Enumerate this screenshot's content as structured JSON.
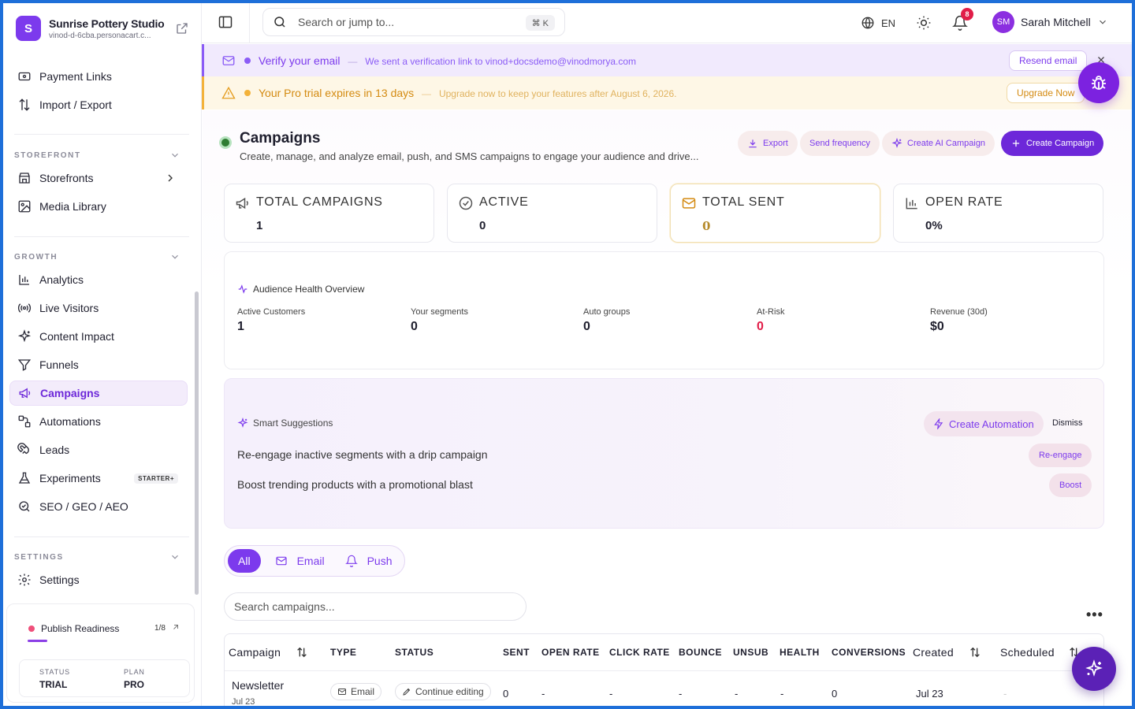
{
  "brand": {
    "initial": "S",
    "name": "Sunrise Pottery Studio",
    "subdomain": "vinod-d-6cba.personacart.c..."
  },
  "sidebar": {
    "top_items": [
      {
        "label": "Payment Links",
        "icon": "card-icon"
      },
      {
        "label": "Import / Export",
        "icon": "import-export-icon"
      }
    ],
    "sections": {
      "storefront": "STOREFRONT",
      "growth": "GROWTH",
      "settings": "SETTINGS"
    },
    "storefront_items": [
      {
        "label": "Storefronts",
        "icon": "store-icon"
      },
      {
        "label": "Media Library",
        "icon": "image-icon"
      }
    ],
    "growth_items": [
      {
        "label": "Analytics",
        "icon": "bar-chart-icon"
      },
      {
        "label": "Live Visitors",
        "icon": "broadcast-icon"
      },
      {
        "label": "Content Impact",
        "icon": "sparkle-icon"
      },
      {
        "label": "Funnels",
        "icon": "funnel-icon"
      },
      {
        "label": "Campaigns",
        "icon": "megaphone-icon",
        "active": true
      },
      {
        "label": "Automations",
        "icon": "workflow-icon"
      },
      {
        "label": "Leads",
        "icon": "magnet-icon"
      },
      {
        "label": "Experiments",
        "icon": "flask-icon",
        "badge": "STARTER+"
      },
      {
        "label": "SEO / GEO / AEO",
        "icon": "seo-search-icon"
      }
    ],
    "settings_items": [
      {
        "label": "Settings",
        "icon": "gear-icon"
      }
    ],
    "readiness": {
      "title": "Publish Readiness",
      "count": "1/8",
      "status_label": "STATUS",
      "status_value": "TRIAL",
      "plan_label": "PLAN",
      "plan_value": "PRO"
    }
  },
  "topbar": {
    "search_placeholder": "Search or jump to...",
    "shortcut": "⌘ K",
    "language": "EN",
    "notifications_count": "8",
    "user_initials": "SM",
    "user_name": "Sarah Mitchell"
  },
  "banners": {
    "verify": {
      "title": "Verify your email",
      "sep": "—",
      "text": "We sent a verification link to vinod+docsdemo@vinodmorya.com",
      "button": "Resend email"
    },
    "trial": {
      "title": "Your Pro trial expires in 13 days",
      "sep": "—",
      "text": "Upgrade now to keep your features after August 6, 2026.",
      "button": "Upgrade Now"
    }
  },
  "page": {
    "title": "Campaigns",
    "description": "Create, manage, and analyze email, push, and SMS campaigns to engage your audience and drive...",
    "actions": {
      "export": "Export",
      "frequency": "Send frequency",
      "ai": "Create AI Campaign",
      "create": "Create Campaign"
    }
  },
  "kpis": [
    {
      "label": "TOTAL CAMPAIGNS",
      "value": "1",
      "icon": "megaphone-icon"
    },
    {
      "label": "ACTIVE",
      "value": "0",
      "icon": "check-circle-icon"
    },
    {
      "label": "TOTAL SENT",
      "value": "0",
      "icon": "mail-icon"
    },
    {
      "label": "OPEN RATE",
      "value": "0%",
      "icon": "bar-chart-icon"
    }
  ],
  "audience": {
    "title": "Audience Health Overview",
    "metrics": [
      {
        "label": "Active Customers",
        "value": "1"
      },
      {
        "label": "Your segments",
        "value": "0"
      },
      {
        "label": "Auto groups",
        "value": "0"
      },
      {
        "label": "At-Risk",
        "value": "0"
      },
      {
        "label": "Revenue (30d)",
        "value": "$0"
      }
    ]
  },
  "suggestions": {
    "title": "Smart Suggestions",
    "create_automation": "Create Automation",
    "dismiss": "Dismiss",
    "rows": [
      {
        "text": "Re-engage inactive segments with a drip campaign",
        "action": "Re-engage"
      },
      {
        "text": "Boost trending products with a promotional blast",
        "action": "Boost"
      }
    ]
  },
  "filters": {
    "all": "All",
    "email": "Email",
    "push": "Push"
  },
  "campaign_search_placeholder": "Search campaigns...",
  "more": "•••",
  "table": {
    "columns": {
      "campaign": "Campaign",
      "type": "TYPE",
      "status": "STATUS",
      "sent": "SENT",
      "open_rate": "OPEN RATE",
      "click_rate": "CLICK RATE",
      "bounce": "BOUNCE",
      "unsub": "UNSUB",
      "health": "HEALTH",
      "conversions": "CONVERSIONS",
      "created": "Created",
      "scheduled": "Scheduled"
    },
    "rows": [
      {
        "name": "Newsletter",
        "date": "Jul 23",
        "type": "Email",
        "status": "Continue editing",
        "sent": "0",
        "open_rate": "-",
        "click_rate": "-",
        "bounce": "-",
        "unsub": "-",
        "health": "-",
        "conversions": "0",
        "created": "Jul 23",
        "scheduled": "-"
      }
    ]
  },
  "colors": {
    "accent": "#7c3aed",
    "accent_dark": "#6d28d9",
    "risk": "#e11d48",
    "trial": "#f3b23a"
  }
}
